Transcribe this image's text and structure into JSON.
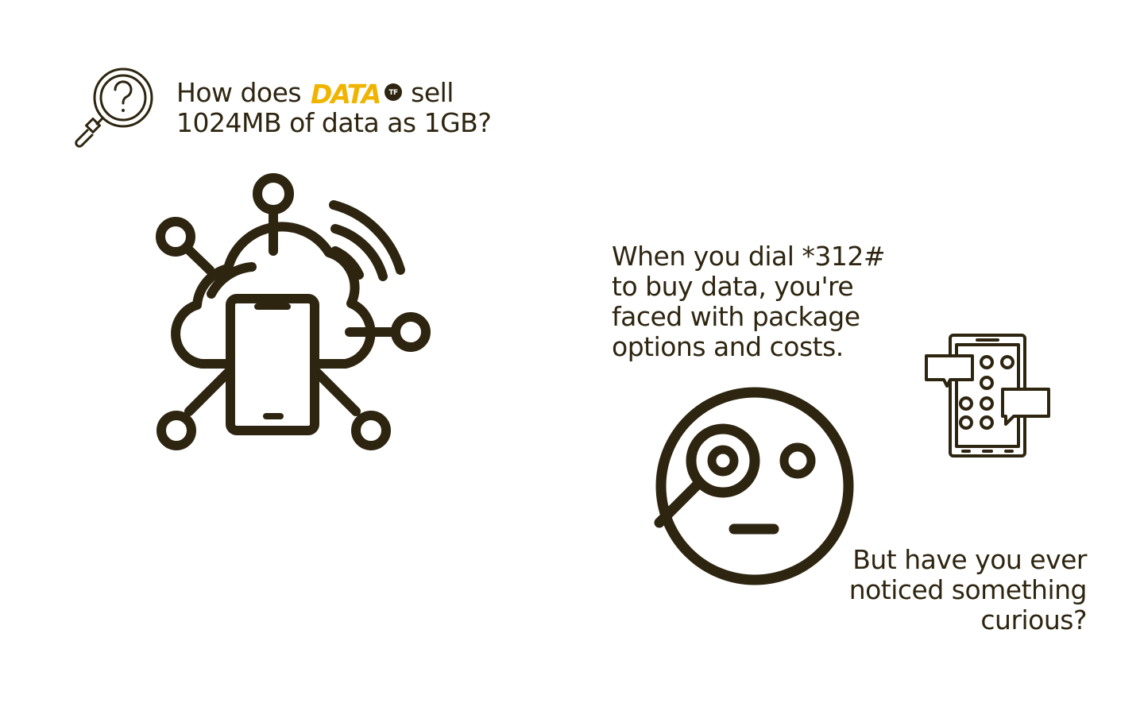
{
  "headline": {
    "line1_before": "How does",
    "logo_text": "DATA",
    "logo_sub": "TF",
    "line1_after": "sell",
    "line2": "1024MB of data as 1GB?"
  },
  "paragraph": {
    "lines": [
      "When you dial *312#",
      "to buy data, you're",
      "faced with package",
      "options and costs."
    ]
  },
  "question": {
    "lines": [
      "But have you ever",
      "noticed something",
      "curious?"
    ]
  },
  "icons": {
    "header": "magnifier-question-icon",
    "network": "cloud-phone-network-icon",
    "face": "face-with-magnifier-icon",
    "phone": "phone-chat-keypad-icon"
  },
  "colors": {
    "ink": "#2e2510",
    "logo_yellow": "#f0b400",
    "background": "#ffffff"
  }
}
